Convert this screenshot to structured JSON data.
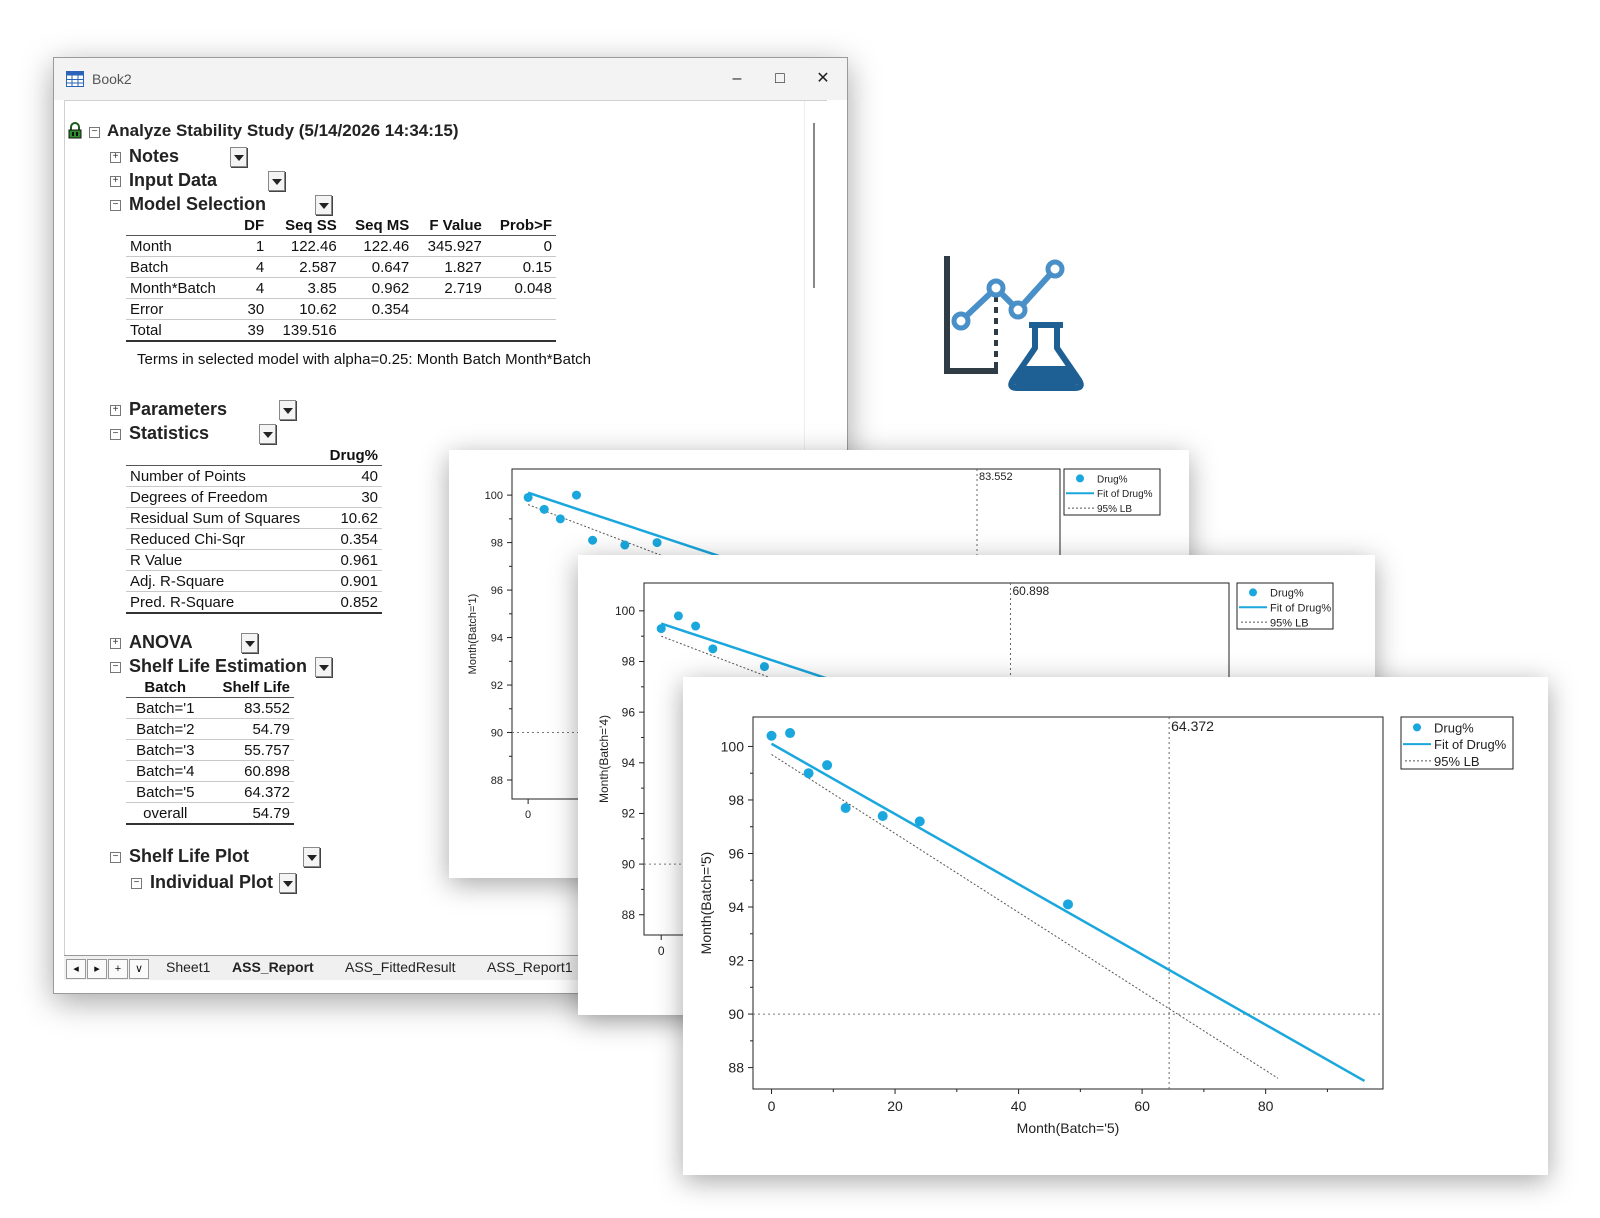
{
  "window": {
    "title": "Book2",
    "controls": {
      "minimize": "–",
      "maximize": "□",
      "close": "✕"
    }
  },
  "report": {
    "root_title": "Analyze Stability Study (5/14/2026 14:34:15)",
    "sections": {
      "notes": "Notes",
      "input_data": "Input Data",
      "model_selection": "Model Selection",
      "parameters": "Parameters",
      "statistics": "Statistics",
      "anova": "ANOVA",
      "shelf_life_estimation": "Shelf Life Estimation",
      "shelf_life_plot": "Shelf Life Plot",
      "individual_plot": "Individual Plot"
    },
    "model_selection": {
      "headers": [
        "",
        "DF",
        "Seq SS",
        "Seq MS",
        "F Value",
        "Prob>F"
      ],
      "rows": [
        [
          "Month",
          "1",
          "122.46",
          "122.46",
          "345.927",
          "0"
        ],
        [
          "Batch",
          "4",
          "2.587",
          "0.647",
          "1.827",
          "0.15"
        ],
        [
          "Month*Batch",
          "4",
          "3.85",
          "0.962",
          "2.719",
          "0.048"
        ],
        [
          "Error",
          "30",
          "10.62",
          "0.354",
          "",
          ""
        ],
        [
          "Total",
          "39",
          "139.516",
          "",
          "",
          ""
        ]
      ],
      "note": "Terms in selected model with alpha=0.25: Month Batch Month*Batch"
    },
    "statistics": {
      "headers": [
        "",
        "Drug%"
      ],
      "rows": [
        [
          "Number of Points",
          "40"
        ],
        [
          "Degrees of Freedom",
          "30"
        ],
        [
          "Residual Sum of Squares",
          "10.62"
        ],
        [
          "Reduced Chi-Sqr",
          "0.354"
        ],
        [
          "R Value",
          "0.961"
        ],
        [
          "Adj. R-Square",
          "0.901"
        ],
        [
          "Pred. R-Square",
          "0.852"
        ]
      ]
    },
    "shelf_life": {
      "headers": [
        "Batch",
        "Shelf Life"
      ],
      "rows": [
        [
          "Batch='1",
          "83.552"
        ],
        [
          "Batch='2",
          "54.79"
        ],
        [
          "Batch='3",
          "55.757"
        ],
        [
          "Batch='4",
          "60.898"
        ],
        [
          "Batch='5",
          "64.372"
        ],
        [
          "overall",
          "54.79"
        ]
      ]
    }
  },
  "tabs": {
    "nav": [
      "◂",
      "▸",
      "+",
      "∨"
    ],
    "sheets": [
      "Sheet1",
      "ASS_Report",
      "ASS_FittedResult",
      "ASS_Report1"
    ],
    "active": "ASS_Report"
  },
  "logo": {
    "icon": "stability-chart-flask-icon",
    "colors": {
      "dark": "#2f3b45",
      "blue": "#4a90c8",
      "flask": "#1e5f94"
    }
  },
  "colors": {
    "series": "#1aa7dd",
    "dotted": "#555555"
  },
  "chart_data": [
    {
      "type": "scatter",
      "ylabel": "Month(Batch='1)",
      "xlabel": "",
      "yticks": [
        88,
        90,
        92,
        94,
        96,
        98,
        100
      ],
      "xticks": [
        0
      ],
      "shelf_life_label": "83.552",
      "legend": [
        "Drug%",
        "Fit of Drug%",
        "95% LB"
      ],
      "x": [
        0,
        3,
        6,
        9,
        12,
        18,
        24
      ],
      "y": [
        99.9,
        99.4,
        99.0,
        100.0,
        98.1,
        97.9,
        98.0
      ]
    },
    {
      "type": "scatter",
      "ylabel": "Month(Batch='4)",
      "xlabel": "",
      "yticks": [
        88,
        90,
        92,
        94,
        96,
        98,
        100
      ],
      "xticks": [
        0
      ],
      "shelf_life_label": "60.898",
      "legend": [
        "Drug%",
        "Fit of Drug%",
        "95% LB"
      ],
      "x": [
        0,
        3,
        6,
        9,
        18
      ],
      "y": [
        99.3,
        99.8,
        99.4,
        98.5,
        97.8
      ]
    },
    {
      "type": "scatter",
      "ylabel": "Month(Batch='5)",
      "xlabel": "Month(Batch='5)",
      "xlim": [
        -3,
        99
      ],
      "ylim": [
        87.2,
        101.1
      ],
      "yticks": [
        88,
        90,
        92,
        94,
        96,
        98,
        100
      ],
      "xticks": [
        0,
        20,
        40,
        60,
        80
      ],
      "shelf_life_label": "64.372",
      "legend": [
        "Drug%",
        "Fit of Drug%",
        "95% LB"
      ],
      "x": [
        0,
        3,
        6,
        9,
        12,
        18,
        24,
        48
      ],
      "y": [
        100.4,
        100.5,
        99.0,
        99.3,
        97.7,
        97.4,
        97.2,
        94.1
      ],
      "fit": {
        "x": [
          0,
          96
        ],
        "y": [
          100.1,
          87.5
        ]
      },
      "lb": {
        "x": [
          0,
          82
        ],
        "y": [
          99.7,
          87.6
        ]
      },
      "spec_limit": 90,
      "shelf_life": 64.372
    }
  ]
}
